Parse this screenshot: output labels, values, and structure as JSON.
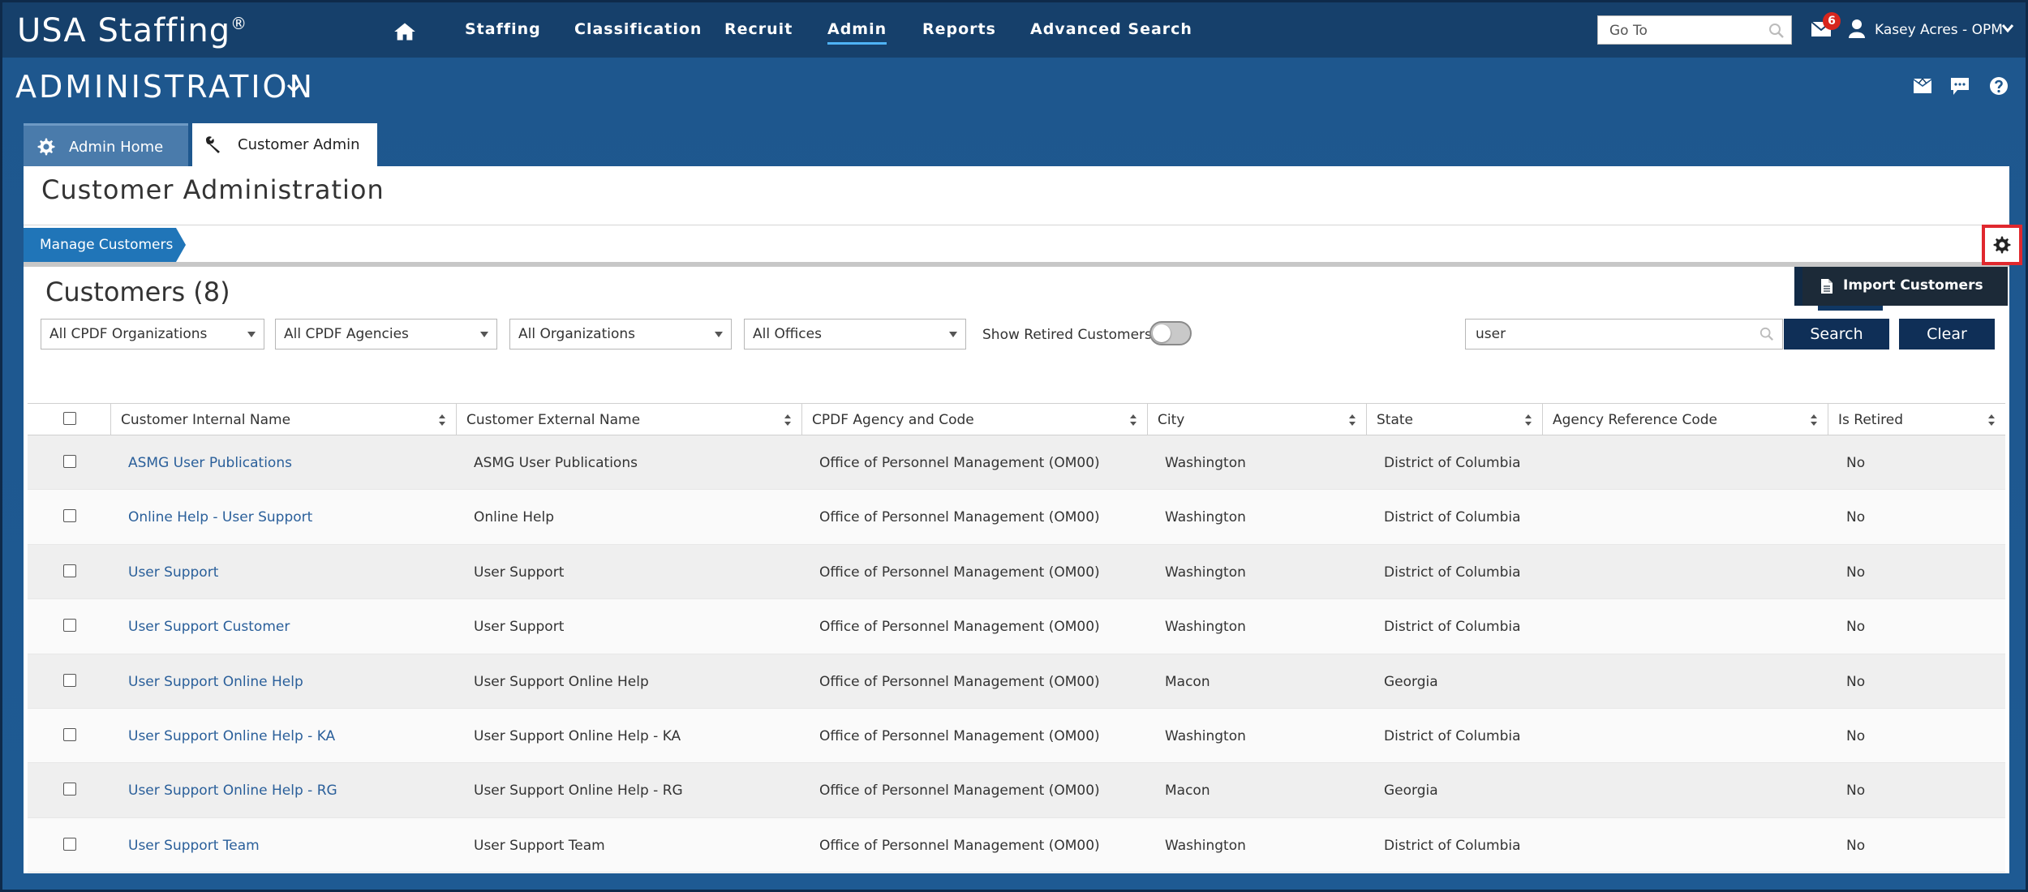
{
  "app": {
    "logo": "USA Staffing",
    "logo_mark": "®"
  },
  "topnav": {
    "items": [
      {
        "label": "Staffing"
      },
      {
        "label": "Classification"
      },
      {
        "label": "Recruit"
      },
      {
        "label": "Admin",
        "active": true
      },
      {
        "label": "Reports"
      },
      {
        "label": "Advanced Search"
      }
    ],
    "goto_placeholder": "Go To",
    "mail_count": "6",
    "user_name": "Kasey Acres - OPM"
  },
  "header": {
    "title": "ADMINISTRATION"
  },
  "tabs": [
    {
      "label": "Admin Home",
      "icon": "gear-icon"
    },
    {
      "label": "Customer Admin",
      "icon": "wrench-icon",
      "active": true
    }
  ],
  "page": {
    "title": "Customer Administration",
    "breadcrumb": "Manage Customers"
  },
  "grid": {
    "title": "Customers (8)",
    "import_label": "Import Customers",
    "filters": [
      {
        "value": "All CPDF Organizations"
      },
      {
        "value": "All CPDF Agencies"
      },
      {
        "value": "All Organizations"
      },
      {
        "value": "All Offices"
      }
    ],
    "show_retired_label": "Show Retired Customers",
    "search_value": "user",
    "search_label": "Search",
    "clear_label": "Clear",
    "columns": [
      "Customer Internal Name",
      "Customer External Name",
      "CPDF Agency and Code",
      "City",
      "State",
      "Agency Reference Code",
      "Is Retired"
    ],
    "rows": [
      {
        "internal": "ASMG User Publications",
        "external": "ASMG User Publications",
        "agency": "Office of Personnel Management (OM00)",
        "city": "Washington",
        "state": "District of Columbia",
        "ref": "",
        "retired": "No"
      },
      {
        "internal": "Online Help - User Support",
        "external": "Online Help",
        "agency": "Office of Personnel Management (OM00)",
        "city": "Washington",
        "state": "District of Columbia",
        "ref": "",
        "retired": "No"
      },
      {
        "internal": "User Support",
        "external": "User Support",
        "agency": "Office of Personnel Management (OM00)",
        "city": "Washington",
        "state": "District of Columbia",
        "ref": "",
        "retired": "No"
      },
      {
        "internal": "User Support Customer",
        "external": "User Support",
        "agency": "Office of Personnel Management (OM00)",
        "city": "Washington",
        "state": "District of Columbia",
        "ref": "",
        "retired": "No"
      },
      {
        "internal": "User Support Online Help",
        "external": "User Support Online Help",
        "agency": "Office of Personnel Management (OM00)",
        "city": "Macon",
        "state": "Georgia",
        "ref": "",
        "retired": "No"
      },
      {
        "internal": "User Support Online Help - KA",
        "external": "User Support Online Help - KA",
        "agency": "Office of Personnel Management (OM00)",
        "city": "Washington",
        "state": "District of Columbia",
        "ref": "",
        "retired": "No"
      },
      {
        "internal": "User Support Online Help - RG",
        "external": "User Support Online Help - RG",
        "agency": "Office of Personnel Management (OM00)",
        "city": "Macon",
        "state": "Georgia",
        "ref": "",
        "retired": "No"
      },
      {
        "internal": "User Support Team",
        "external": "User Support Team",
        "agency": "Office of Personnel Management (OM00)",
        "city": "Washington",
        "state": "District of Columbia",
        "ref": "",
        "retired": "No"
      }
    ]
  },
  "colors": {
    "nav_bg": "#16406b",
    "page_bg": "#1e578e",
    "accent": "#2075b8",
    "button": "#0f2f57",
    "link": "#2a5f9a",
    "highlight": "#e0282e"
  }
}
